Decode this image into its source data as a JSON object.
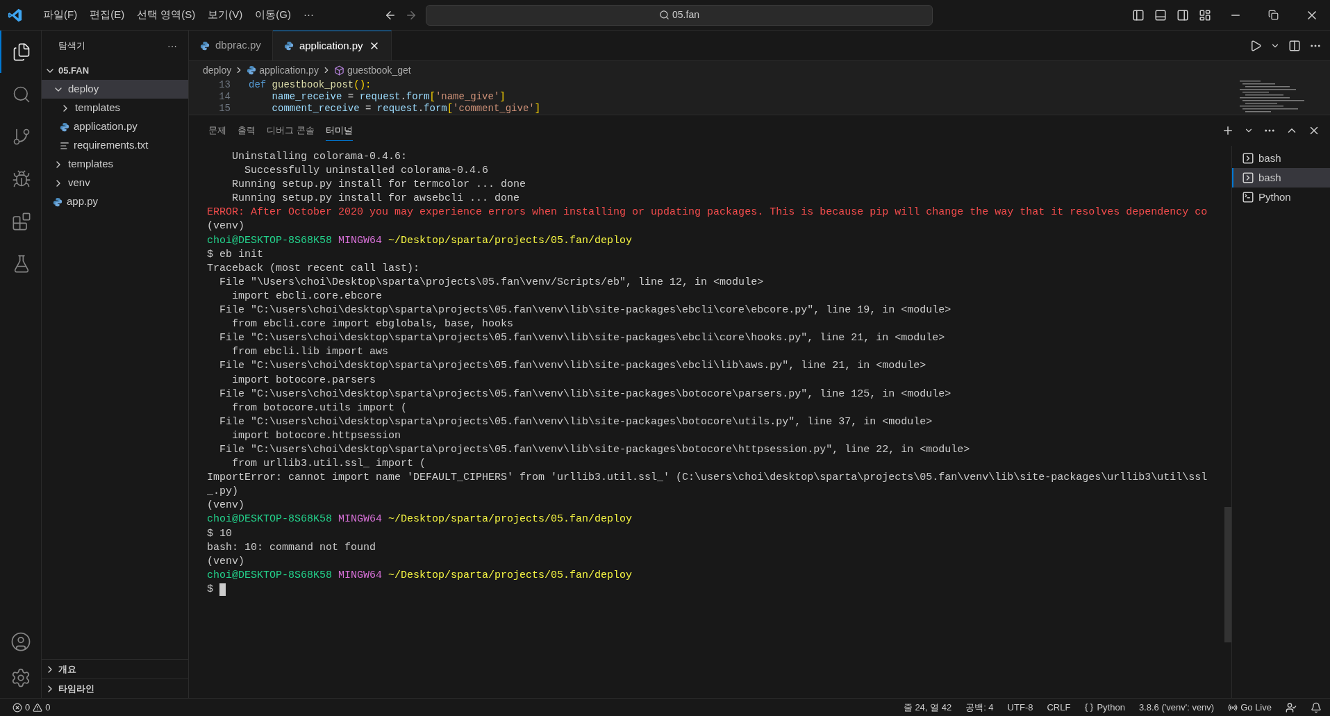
{
  "menu": [
    "파일(F)",
    "편집(E)",
    "선택 영역(S)",
    "보기(V)",
    "이동(G)",
    "···"
  ],
  "search": {
    "value": "05.fan"
  },
  "activity": [
    {
      "kind": "files",
      "selected": true
    },
    {
      "kind": "search",
      "selected": false
    },
    {
      "kind": "git",
      "selected": false
    },
    {
      "kind": "debug",
      "selected": false
    },
    {
      "kind": "extensions",
      "selected": false
    },
    {
      "kind": "test",
      "selected": false
    }
  ],
  "sidebar": {
    "title": "탐색기",
    "more": "···",
    "root": "05.FAN",
    "items": [
      {
        "label": "deploy",
        "kind": "folder",
        "expanded": true,
        "selected": true,
        "children": [
          {
            "label": "templates",
            "kind": "folder",
            "expanded": false,
            "selected": false
          },
          {
            "label": "application.py",
            "kind": "python",
            "selected": false
          },
          {
            "label": "requirements.txt",
            "kind": "text",
            "selected": false
          }
        ]
      },
      {
        "label": "templates",
        "kind": "folder",
        "expanded": false,
        "selected": false
      },
      {
        "label": "venv",
        "kind": "folder",
        "expanded": false,
        "selected": false
      },
      {
        "label": "app.py",
        "kind": "python",
        "selected": false
      }
    ],
    "sections": [
      "개요",
      "타임라인"
    ]
  },
  "tabs": [
    {
      "label": "dbprac.py",
      "selected": false
    },
    {
      "label": "application.py",
      "selected": true
    }
  ],
  "breadcrumb": [
    "deploy",
    "application.py",
    "guestbook_get"
  ],
  "code": [
    {
      "line": "13",
      "segments": [
        {
          "text": "def ",
          "kind": "keyword"
        },
        {
          "text": "guestbook_post",
          "kind": "func"
        },
        {
          "text": "():",
          "kind": "paren"
        }
      ]
    },
    {
      "line": "14",
      "segments": [
        {
          "text": "    name_receive",
          "kind": "var"
        },
        {
          "text": " = ",
          "kind": "plain"
        },
        {
          "text": "request",
          "kind": "var"
        },
        {
          "text": ".",
          "kind": "plain"
        },
        {
          "text": "form",
          "kind": "var"
        },
        {
          "text": "[",
          "kind": "paren"
        },
        {
          "text": "'name_give'",
          "kind": "string"
        },
        {
          "text": "]",
          "kind": "paren"
        }
      ]
    },
    {
      "line": "15",
      "segments": [
        {
          "text": "    comment_receive",
          "kind": "var"
        },
        {
          "text": " = ",
          "kind": "plain"
        },
        {
          "text": "request",
          "kind": "var"
        },
        {
          "text": ".",
          "kind": "plain"
        },
        {
          "text": "form",
          "kind": "var"
        },
        {
          "text": "[",
          "kind": "paren"
        },
        {
          "text": "'comment_give'",
          "kind": "string"
        },
        {
          "text": "]",
          "kind": "paren"
        }
      ]
    }
  ],
  "panel_tabs": [
    {
      "label": "문제",
      "selected": false
    },
    {
      "label": "출력",
      "selected": false
    },
    {
      "label": "디버그 콘솔",
      "selected": false
    },
    {
      "label": "터미널",
      "selected": true
    }
  ],
  "terminal": [
    [
      {
        "text": "    Uninstalling colorama-0.4.6:",
        "kind": "plain"
      }
    ],
    [
      {
        "text": "      Successfully uninstalled colorama-0.4.6",
        "kind": "plain"
      }
    ],
    [
      {
        "text": "    Running setup.py install for termcolor ... done",
        "kind": "plain"
      }
    ],
    [
      {
        "text": "    Running setup.py install for awsebcli ... done",
        "kind": "plain"
      }
    ],
    [
      {
        "text": "ERROR: After October 2020 you may experience errors when installing or updating packages. This is because pip will change the way that it resolves dependency co",
        "kind": "error"
      }
    ],
    [
      {
        "text": "(venv)",
        "kind": "plain"
      }
    ],
    [
      {
        "text": "choi@DESKTOP-8S68K58 ",
        "kind": "user"
      },
      {
        "text": "MINGW64 ",
        "kind": "host"
      },
      {
        "text": "~/Desktop/sparta/projects/05.fan/deploy",
        "kind": "path"
      }
    ],
    [
      {
        "text": "$ eb init",
        "kind": "plain"
      }
    ],
    [
      {
        "text": "Traceback (most recent call last):",
        "kind": "plain"
      }
    ],
    [
      {
        "text": "  File \"\\Users\\choi\\Desktop\\sparta\\projects\\05.fan\\venv/Scripts/eb\", line 12, in <module>",
        "kind": "plain"
      }
    ],
    [
      {
        "text": "    import ebcli.core.ebcore",
        "kind": "plain"
      }
    ],
    [
      {
        "text": "  File \"C:\\users\\choi\\desktop\\sparta\\projects\\05.fan\\venv\\lib\\site-packages\\ebcli\\core\\ebcore.py\", line 19, in <module>",
        "kind": "plain"
      }
    ],
    [
      {
        "text": "    from ebcli.core import ebglobals, base, hooks",
        "kind": "plain"
      }
    ],
    [
      {
        "text": "  File \"C:\\users\\choi\\desktop\\sparta\\projects\\05.fan\\venv\\lib\\site-packages\\ebcli\\core\\hooks.py\", line 21, in <module>",
        "kind": "plain"
      }
    ],
    [
      {
        "text": "    from ebcli.lib import aws",
        "kind": "plain"
      }
    ],
    [
      {
        "text": "  File \"C:\\users\\choi\\desktop\\sparta\\projects\\05.fan\\venv\\lib\\site-packages\\ebcli\\lib\\aws.py\", line 21, in <module>",
        "kind": "plain"
      }
    ],
    [
      {
        "text": "    import botocore.parsers",
        "kind": "plain"
      }
    ],
    [
      {
        "text": "  File \"C:\\users\\choi\\desktop\\sparta\\projects\\05.fan\\venv\\lib\\site-packages\\botocore\\parsers.py\", line 125, in <module>",
        "kind": "plain"
      }
    ],
    [
      {
        "text": "    from botocore.utils import (",
        "kind": "plain"
      }
    ],
    [
      {
        "text": "  File \"C:\\users\\choi\\desktop\\sparta\\projects\\05.fan\\venv\\lib\\site-packages\\botocore\\utils.py\", line 37, in <module>",
        "kind": "plain"
      }
    ],
    [
      {
        "text": "    import botocore.httpsession",
        "kind": "plain"
      }
    ],
    [
      {
        "text": "  File \"C:\\users\\choi\\desktop\\sparta\\projects\\05.fan\\venv\\lib\\site-packages\\botocore\\httpsession.py\", line 22, in <module>",
        "kind": "plain"
      }
    ],
    [
      {
        "text": "    from urllib3.util.ssl_ import (",
        "kind": "plain"
      }
    ],
    [
      {
        "text": "ImportError: cannot import name 'DEFAULT_CIPHERS' from 'urllib3.util.ssl_' (C:\\users\\choi\\desktop\\sparta\\projects\\05.fan\\venv\\lib\\site-packages\\urllib3\\util\\ssl",
        "kind": "plain"
      }
    ],
    [
      {
        "text": "_.py)",
        "kind": "plain"
      }
    ],
    [
      {
        "text": "(venv)",
        "kind": "plain"
      }
    ],
    [
      {
        "text": "choi@DESKTOP-8S68K58 ",
        "kind": "user"
      },
      {
        "text": "MINGW64 ",
        "kind": "host"
      },
      {
        "text": "~/Desktop/sparta/projects/05.fan/deploy",
        "kind": "path"
      }
    ],
    [
      {
        "text": "$ 10",
        "kind": "plain"
      }
    ],
    [
      {
        "text": "bash: 10: command not found",
        "kind": "plain"
      }
    ],
    [
      {
        "text": "(venv)",
        "kind": "plain"
      }
    ],
    [
      {
        "text": "choi@DESKTOP-8S68K58 ",
        "kind": "user"
      },
      {
        "text": "MINGW64 ",
        "kind": "host"
      },
      {
        "text": "~/Desktop/sparta/projects/05.fan/deploy",
        "kind": "path"
      }
    ],
    [
      {
        "text": "$ ",
        "kind": "plain",
        "cursor": true
      }
    ]
  ],
  "terminals": [
    {
      "label": "bash",
      "kind": "bash",
      "selected": false
    },
    {
      "label": "bash",
      "kind": "bash",
      "selected": true
    },
    {
      "label": "Python",
      "kind": "python",
      "selected": false
    }
  ],
  "status": {
    "errors": "0",
    "warnings": "0",
    "items": [
      "줄 24, 열 42",
      "공백: 4",
      "UTF-8",
      "CRLF",
      "Python",
      "3.8.6 ('venv': venv)",
      "Go Live"
    ]
  }
}
